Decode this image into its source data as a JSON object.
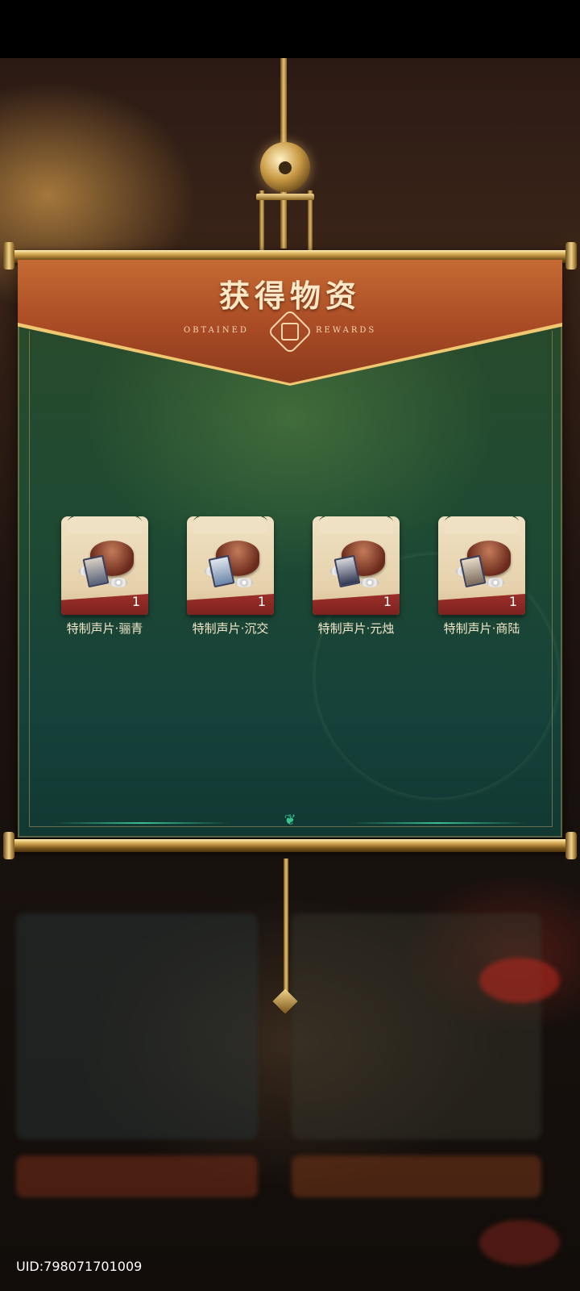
{
  "header": {
    "title": "获得物资",
    "subtitle_left": "OBTAINED",
    "subtitle_right": "REWARDS"
  },
  "rewards": [
    {
      "name": "特制声片·骊青",
      "count": "1"
    },
    {
      "name": "特制声片·沉交",
      "count": "1"
    },
    {
      "name": "特制声片·元烛",
      "count": "1"
    },
    {
      "name": "特制声片·商陆",
      "count": "1"
    }
  ],
  "footer": {
    "uid": "UID:798071701009"
  },
  "colors": {
    "banner": "#a84a25",
    "board": "#1f4a32",
    "gold": "#d8ab55",
    "accent_teal": "#3bc08f"
  }
}
